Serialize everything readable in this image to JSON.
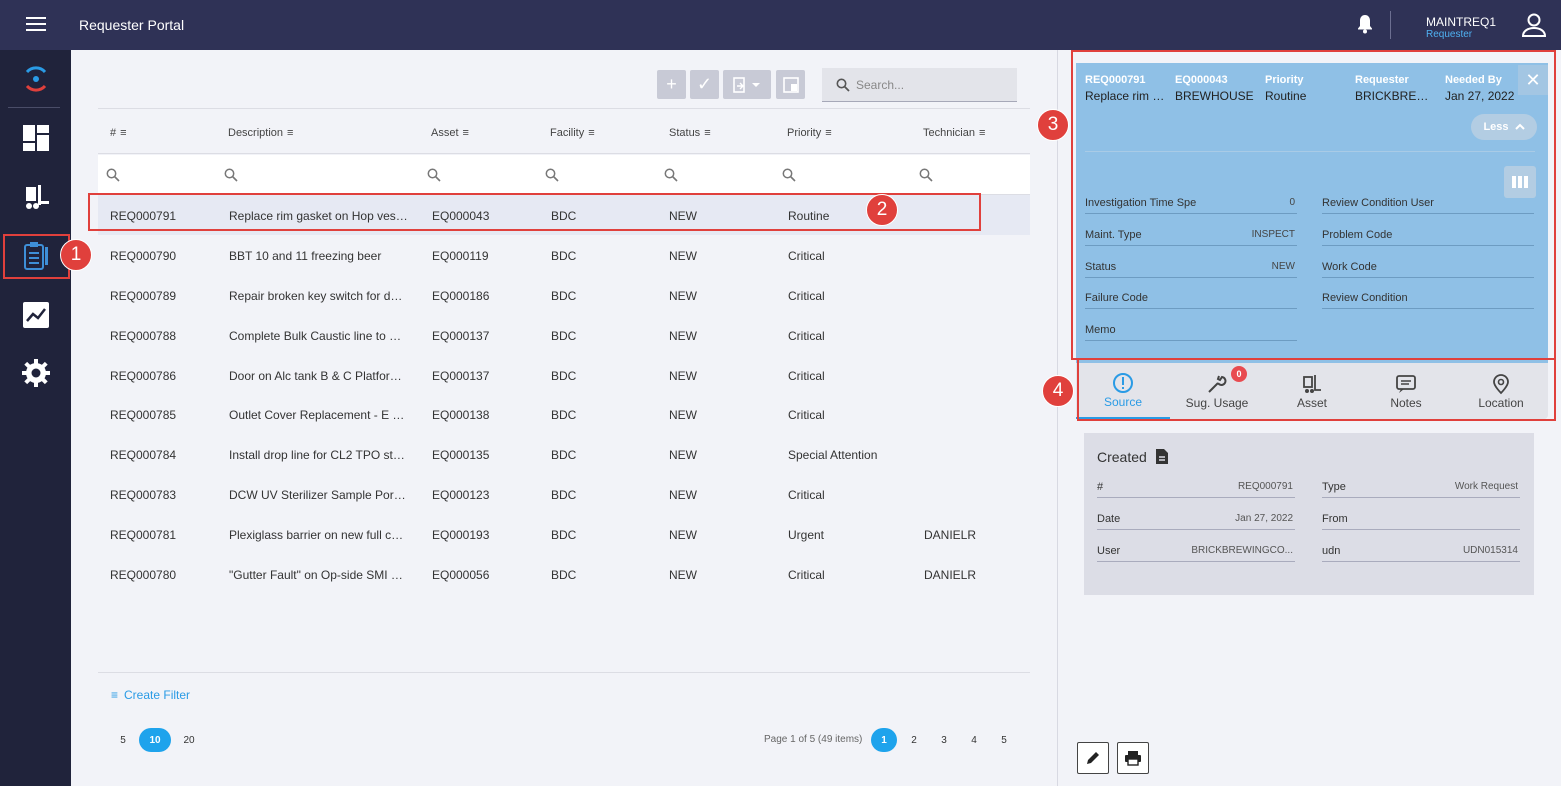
{
  "app": {
    "title": "Requester Portal"
  },
  "user": {
    "name": "MAINTREQ1",
    "role": "Requester"
  },
  "toolbar": {
    "search_placeholder": "Search..."
  },
  "grid": {
    "columns": [
      "#",
      "Description",
      "Asset",
      "Facility",
      "Status",
      "Priority",
      "Technician"
    ],
    "rows": [
      [
        "REQ000791",
        "Replace rim gasket on Hop vesse...",
        "EQ000043",
        "BDC",
        "NEW",
        "Routine",
        ""
      ],
      [
        "REQ000790",
        "BBT 10 and 11 freezing beer",
        "EQ000119",
        "BDC",
        "NEW",
        "Critical",
        ""
      ],
      [
        "REQ000789",
        "Repair broken key switch for door...",
        "EQ000186",
        "BDC",
        "NEW",
        "Critical",
        ""
      ],
      [
        "REQ000788",
        "Complete Bulk Caustic line to NA...",
        "EQ000137",
        "BDC",
        "NEW",
        "Critical",
        ""
      ],
      [
        "REQ000786",
        "Door on Alc tank B & C Platform ...",
        "EQ000137",
        "BDC",
        "NEW",
        "Critical",
        ""
      ],
      [
        "REQ000785",
        "Outlet Cover Replacement - E Cell...",
        "EQ000138",
        "BDC",
        "NEW",
        "Critical",
        ""
      ],
      [
        "REQ000784",
        "Install drop line for CL2 TPO stati...",
        "EQ000135",
        "BDC",
        "NEW",
        "Special Attention",
        ""
      ],
      [
        "REQ000783",
        "DCW UV Sterilizer Sample Ports ...",
        "EQ000123",
        "BDC",
        "NEW",
        "Critical",
        ""
      ],
      [
        "REQ000781",
        "Plexiglass barrier on new full cas...",
        "EQ000193",
        "BDC",
        "NEW",
        "Urgent",
        "DANIELR"
      ],
      [
        "REQ000780",
        "\"Gutter Fault\" on Op-side SMI Cod...",
        "EQ000056",
        "BDC",
        "NEW",
        "Critical",
        "DANIELR"
      ]
    ]
  },
  "footer": {
    "create_filter": "Create Filter",
    "page_sizes": [
      "5",
      "10",
      "20"
    ],
    "page_info": "Page 1 of 5 (49 items)",
    "pages": [
      "1",
      "2",
      "3",
      "4",
      "5"
    ]
  },
  "detail": {
    "header": [
      {
        "label": "REQ000791",
        "value": "Replace rim ga..."
      },
      {
        "label": "EQ000043",
        "value": "BREWHOUSE"
      },
      {
        "label": "Priority",
        "value": "Routine"
      },
      {
        "label": "Requester",
        "value": "BRICKBREWIN..."
      },
      {
        "label": "Needed By",
        "value": "Jan 27, 2022"
      }
    ],
    "less_label": "Less",
    "fields_left": [
      {
        "label": "Investigation Time Spe",
        "value": "0"
      },
      {
        "label": "Maint. Type",
        "value": "INSPECT"
      },
      {
        "label": "Status",
        "value": "NEW"
      },
      {
        "label": "Failure Code",
        "value": ""
      },
      {
        "label": "Memo",
        "value": ""
      }
    ],
    "fields_right": [
      {
        "label": "Review Condition User",
        "value": ""
      },
      {
        "label": "Problem Code",
        "value": ""
      },
      {
        "label": "Work Code",
        "value": ""
      },
      {
        "label": "Review Condition",
        "value": ""
      }
    ]
  },
  "tabs": [
    {
      "label": "Source",
      "icon": "info-circle-icon"
    },
    {
      "label": "Sug. Usage",
      "icon": "wrench-icon",
      "badge": "0"
    },
    {
      "label": "Asset",
      "icon": "forklift-icon"
    },
    {
      "label": "Notes",
      "icon": "notes-icon"
    },
    {
      "label": "Location",
      "icon": "location-pin-icon"
    }
  ],
  "created": {
    "title": "Created",
    "left": [
      {
        "label": "#",
        "value": "REQ000791"
      },
      {
        "label": "Date",
        "value": "Jan 27, 2022"
      },
      {
        "label": "User",
        "value": "BRICKBREWINGCO..."
      }
    ],
    "right": [
      {
        "label": "Type",
        "value": "Work Request"
      },
      {
        "label": "From",
        "value": ""
      },
      {
        "label": "udn",
        "value": "UDN015314"
      }
    ]
  },
  "annotations": [
    "1",
    "2",
    "3",
    "4"
  ],
  "colors": {
    "topbar": "#2f3256",
    "rail": "#20233b",
    "accent": "#1ea3ec",
    "detail_bg": "#8fc0e6",
    "annotation": "#e0403c"
  }
}
